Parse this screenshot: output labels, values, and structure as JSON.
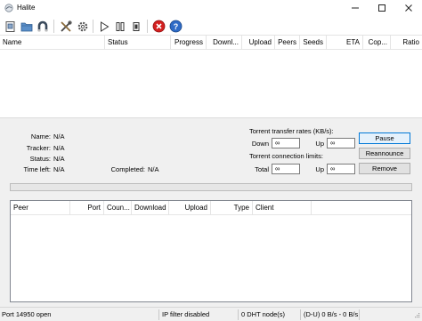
{
  "window": {
    "title": "Halite"
  },
  "toolbar": {
    "buttons": [
      {
        "name": "open-torrent",
        "icon": "open-torrent-icon"
      },
      {
        "name": "open-folder",
        "icon": "folder-icon"
      },
      {
        "name": "magnet",
        "icon": "magnet-icon"
      },
      {
        "name": "settings-tools",
        "icon": "tools-icon"
      },
      {
        "name": "preferences",
        "icon": "gear-icon"
      },
      {
        "name": "start",
        "icon": "play-icon"
      },
      {
        "name": "pause",
        "icon": "pause-icon"
      },
      {
        "name": "stop",
        "icon": "stop-icon"
      },
      {
        "name": "remove",
        "icon": "remove-icon"
      },
      {
        "name": "help",
        "icon": "help-icon"
      }
    ]
  },
  "torrent_list": {
    "columns": [
      "Name",
      "Status",
      "Progress",
      "Downl...",
      "Upload",
      "Peers",
      "Seeds",
      "ETA",
      "Cop...",
      "Ratio"
    ],
    "rows": []
  },
  "details": {
    "name_label": "Name:",
    "name_value": "N/A",
    "tracker_label": "Tracker:",
    "tracker_value": "N/A",
    "status_label": "Status:",
    "status_value": "N/A",
    "time_left_label": "Time left:",
    "time_left_value": "N/A",
    "completed_label": "Completed:",
    "completed_value": "N/A",
    "rates_title": "Torrent transfer rates (KB/s):",
    "down_label": "Down",
    "down_value": "∞",
    "up_label": "Up",
    "up_value": "∞",
    "limits_title": "Torrent connection limits:",
    "total_label": "Total",
    "total_value": "∞",
    "up2_label": "Up",
    "up2_value": "∞",
    "pause_button": "Pause",
    "reannounce_button": "Reannounce",
    "remove_button": "Remove",
    "progress": 0
  },
  "peers_list": {
    "columns": [
      "Peer",
      "Port",
      "Coun...",
      "Download",
      "Upload",
      "Type",
      "Client"
    ],
    "rows": []
  },
  "statusbar": {
    "port": "Port 14950 open",
    "ip_filter": "IP filter disabled",
    "dht": "0 DHT node(s)",
    "rates": "(D-U) 0 B/s - 0 B/s"
  },
  "colors": {
    "accent": "#0078d7",
    "panel_bg": "#f0f0f0",
    "remove_red": "#d42020",
    "help_blue": "#2e6bc7"
  }
}
